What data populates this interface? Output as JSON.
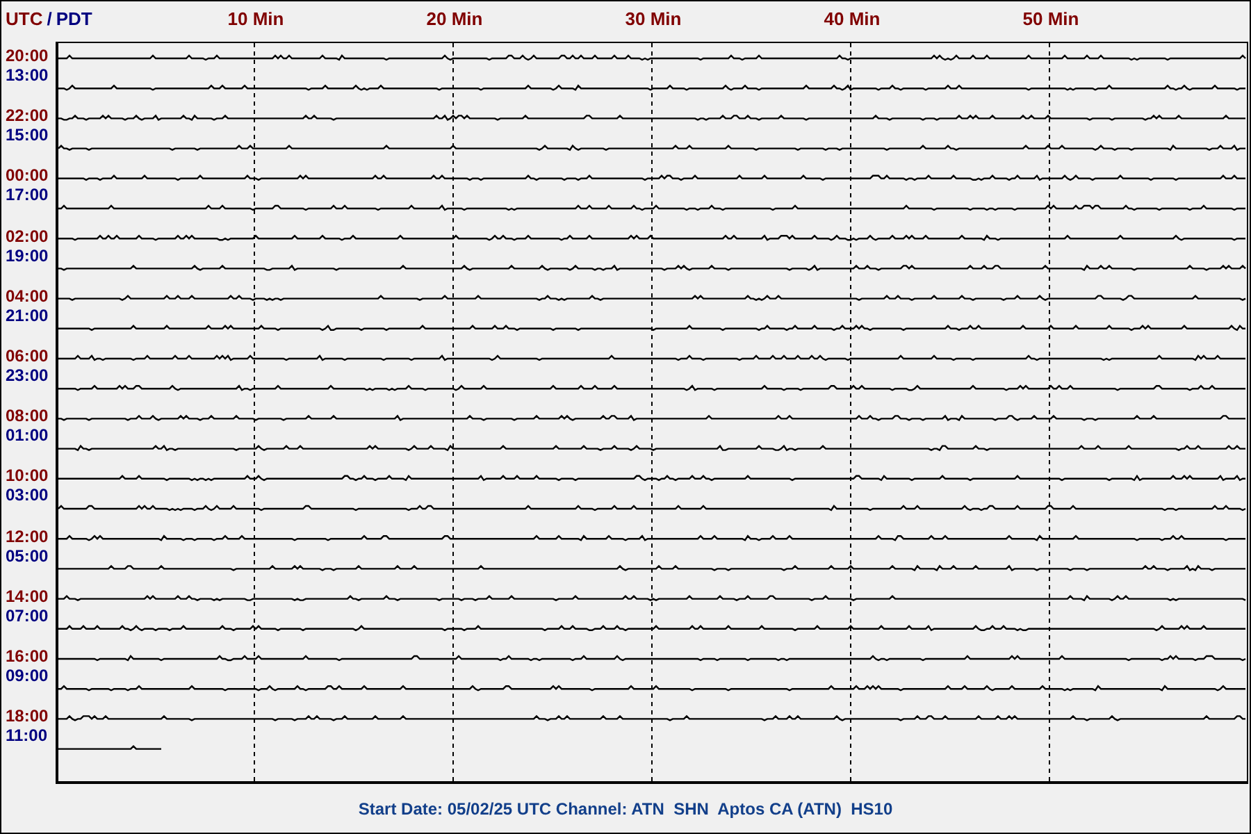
{
  "header": {
    "utc_label": "UTC",
    "separator": "/",
    "local_label": "PDT"
  },
  "time_axis": [
    "10 Min",
    "20 Min",
    "30 Min",
    "40 Min",
    "50 Min"
  ],
  "rows": [
    {
      "utc": "20:00",
      "local": "13:00"
    },
    {
      "utc": "22:00",
      "local": "15:00"
    },
    {
      "utc": "00:00",
      "local": "17:00"
    },
    {
      "utc": "02:00",
      "local": "19:00"
    },
    {
      "utc": "04:00",
      "local": "21:00"
    },
    {
      "utc": "06:00",
      "local": "23:00"
    },
    {
      "utc": "08:00",
      "local": "01:00"
    },
    {
      "utc": "10:00",
      "local": "03:00"
    },
    {
      "utc": "12:00",
      "local": "05:00"
    },
    {
      "utc": "14:00",
      "local": "07:00"
    },
    {
      "utc": "16:00",
      "local": "09:00"
    },
    {
      "utc": "18:00",
      "local": "11:00"
    }
  ],
  "footer": "Start Date: 05/02/25 UTC Channel: ATN  SHN  Aptos CA (ATN)  HS10"
}
